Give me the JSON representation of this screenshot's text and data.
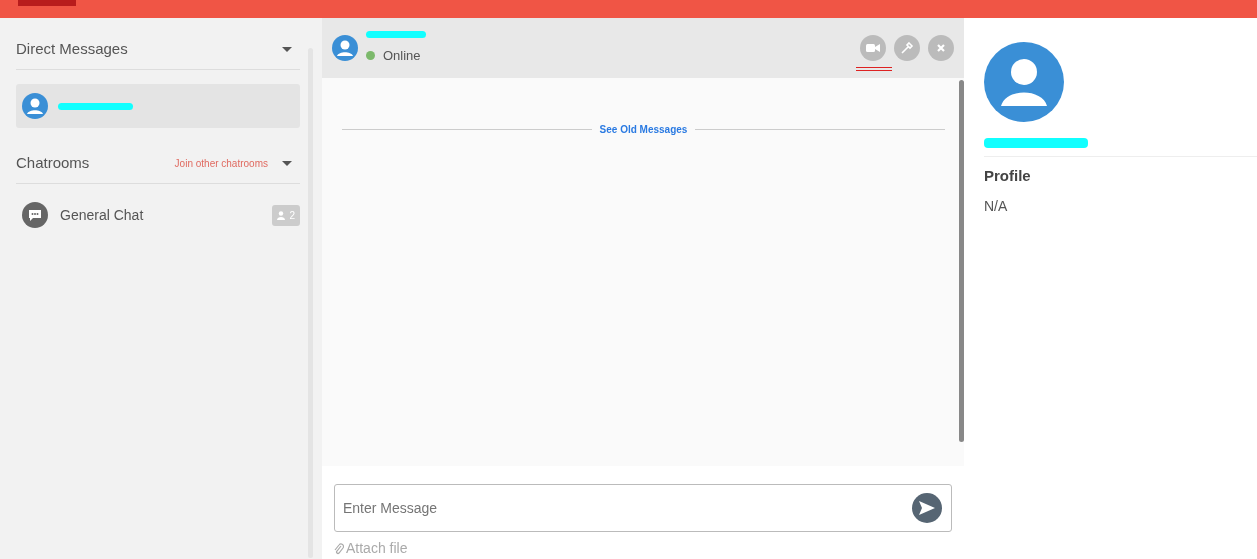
{
  "sidebar": {
    "direct_messages": {
      "title": "Direct Messages",
      "items": [
        {
          "selected": true
        }
      ]
    },
    "chatrooms": {
      "title": "Chatrooms",
      "join_link": "Join other chatrooms",
      "rooms": [
        {
          "name": "General Chat",
          "count": "2"
        }
      ]
    }
  },
  "chat": {
    "status": "Online",
    "online": true,
    "actions": [
      {
        "kind": "video"
      },
      {
        "kind": "eyedropper"
      },
      {
        "kind": "close"
      }
    ],
    "old_messages_link": "See Old Messages",
    "input": {
      "placeholder": "Enter Message"
    },
    "attach": "Attach file"
  },
  "profile": {
    "heading": "Profile",
    "value": "N/A"
  }
}
